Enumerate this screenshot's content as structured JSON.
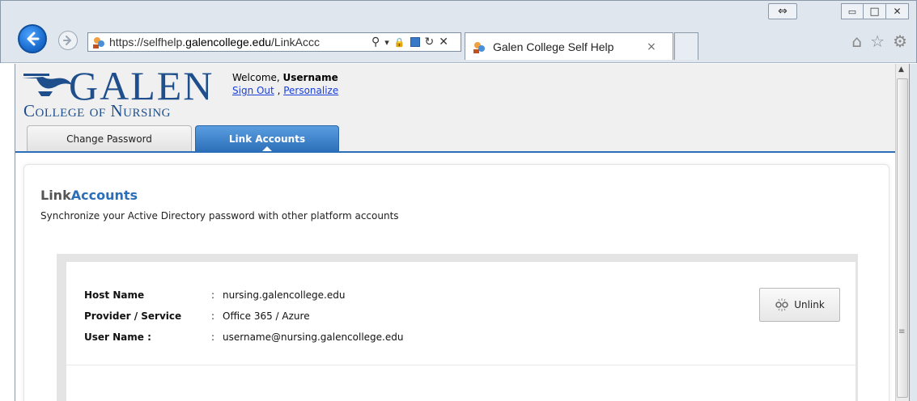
{
  "browser": {
    "url_prefix": "https://selfhelp.",
    "url_domain": "galencollege.edu",
    "url_path": "/LinkAccc",
    "tab_title": "Galen College Self Help",
    "tab_close": "×",
    "search_glyph": "⚲",
    "dropdown_glyph": "▾",
    "lock_glyph": "🔒",
    "refresh_glyph": "↻",
    "stop_glyph": "✕",
    "home_glyph": "⌂",
    "star_glyph": "☆",
    "gear_glyph": "⚙",
    "resize_glyph": "⇔",
    "min_glyph": "▭",
    "max_glyph": "□",
    "close_glyph": "✕"
  },
  "header": {
    "logo_word": "GALEN",
    "logo_sub": "College of Nursing",
    "welcome_prefix": "Welcome, ",
    "username": "Username",
    "sign_out": "Sign Out",
    "link_sep": " , ",
    "personalize": "Personalize"
  },
  "tabs": [
    {
      "label": "Change Password",
      "active": false
    },
    {
      "label": "Link Accounts",
      "active": true
    }
  ],
  "page": {
    "heading_part1": "Link",
    "heading_part2": "Accounts",
    "description": "Synchronize your Active Directory password with other platform accounts"
  },
  "account": {
    "rows": [
      {
        "label": "Host Name",
        "sep": ":",
        "value": "nursing.galencollege.edu"
      },
      {
        "label": "Provider / Service",
        "sep": ":",
        "value": "Office 365 / Azure"
      },
      {
        "label": "User Name :",
        "sep": ":",
        "value": "username@nursing.galencollege.edu"
      }
    ],
    "unlink_label": "Unlink"
  },
  "colors": {
    "brand_blue": "#1e4f8c",
    "tab_active": "#2b6fb8",
    "link": "#1a3fd6"
  }
}
